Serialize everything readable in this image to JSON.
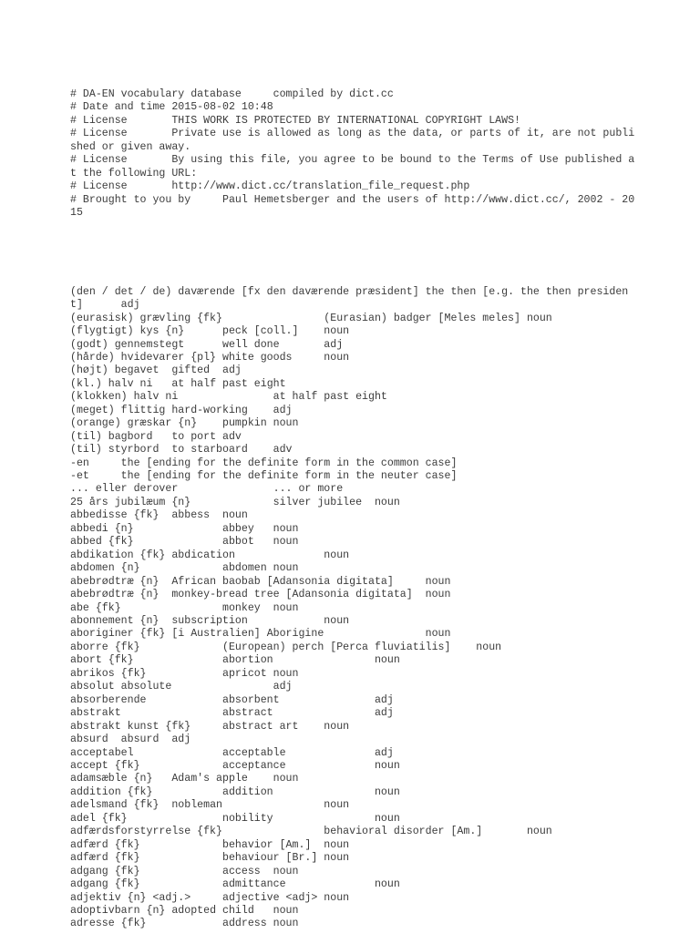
{
  "document": {
    "kind": "plain-text-file",
    "encoding_note": "monospace plain text dump",
    "header_lines": [
      "# DA-EN vocabulary database\tcompiled by dict.cc",
      "# Date and time\t2015-08-02 10:48",
      "# License\tTHIS WORK IS PROTECTED BY INTERNATIONAL COPYRIGHT LAWS!",
      "# License\tPrivate use is allowed as long as the data, or parts of it, are not published or given away.",
      "# License\tBy using this file, you agree to be bound to the Terms of Use published at the following URL:",
      "# License\thttp://www.dict.cc/translation_file_request.php",
      "# Brought to you by\tPaul Hemetsberger and the users of http://www.dict.cc/, 2002 - 2015"
    ],
    "entry_lines": [
      "(den / det / de) daværende [fx den daværende præsident]\tthe then [e.g. the then president]\tadj",
      "(eurasisk) grævling {fk}\t\t(Eurasian) badger [Meles meles]\tnoun",
      "(flygtigt) kys {n}\tpeck [coll.]\tnoun",
      "(godt) gennemstegt\twell done\tadj",
      "(hårde) hvidevarer {pl}\twhite goods\tnoun",
      "(højt) begavet\tgifted\tadj",
      "(kl.) halv ni\tat half past eight",
      "(klokken) halv ni\t\tat half past eight",
      "(meget) flittig\thard-working\tadj",
      "(orange) græskar {n}\tpumpkin\tnoun",
      "(til) bagbord\tto port\tadv",
      "(til) styrbord\tto starboard\tadv",
      "-en\tthe [ending for the definite form in the common case]",
      "-et\tthe [ending for the definite form in the neuter case]",
      "... eller derover\t\t... or more",
      "25 års jubilæum {n}\t\tsilver jubilee\tnoun",
      "abbedisse {fk}\tabbess\tnoun",
      "abbedi {n}\t\tabbey\tnoun",
      "abbed {fk}\t\tabbot\tnoun",
      "abdikation {fk}\tabdication\t\tnoun",
      "abdomen {n}\t\tabdomen\tnoun",
      "abebrødtræ {n}\tAfrican baobab [Adansonia digitata]\tnoun",
      "abebrødtræ {n}\tmonkey-bread tree [Adansonia digitata]\tnoun",
      "abe {fk}\t\tmonkey\tnoun",
      "abonnement {n}\tsubscription\t\tnoun",
      "aboriginer {fk}\t[i Australien] Aborigine\t\tnoun",
      "aborre {fk}\t\t(European) perch [Perca fluviatilis]\tnoun",
      "abort {fk}\t\tabortion\t\tnoun",
      "abrikos {fk}\t\tapricot\tnoun",
      "absolut\tabsolute\t\tadj",
      "absorberende\t\tabsorbent\t\tadj",
      "abstrakt\t\tabstract\t\tadj",
      "abstrakt kunst {fk}\tabstract art\tnoun",
      "absurd\tabsurd\tadj",
      "acceptabel\t\tacceptable\t\tadj",
      "accept {fk}\t\tacceptance\t\tnoun",
      "adamsæble {n}\tAdam's apple\tnoun",
      "addition {fk}\t\taddition\t\tnoun",
      "adelsmand {fk}\tnobleman\t\tnoun",
      "adel {fk}\t\tnobility\t\tnoun",
      "adfærdsforstyrrelse {fk}\t\tbehavioral disorder [Am.]\tnoun",
      "adfærd {fk}\t\tbehavior [Am.]\tnoun",
      "adfærd {fk}\t\tbehaviour [Br.]\tnoun",
      "adgang {fk}\t\taccess\tnoun",
      "adgang {fk}\t\tadmittance\t\tnoun",
      "adjektiv {n} <adj.>\tadjective <adj>\tnoun",
      "adoptivbarn {n}\tadopted child\tnoun",
      "adresse {fk}\t\taddress\tnoun"
    ]
  },
  "style": {
    "text_color": "#3b3b3b",
    "background_color": "#ffffff"
  }
}
